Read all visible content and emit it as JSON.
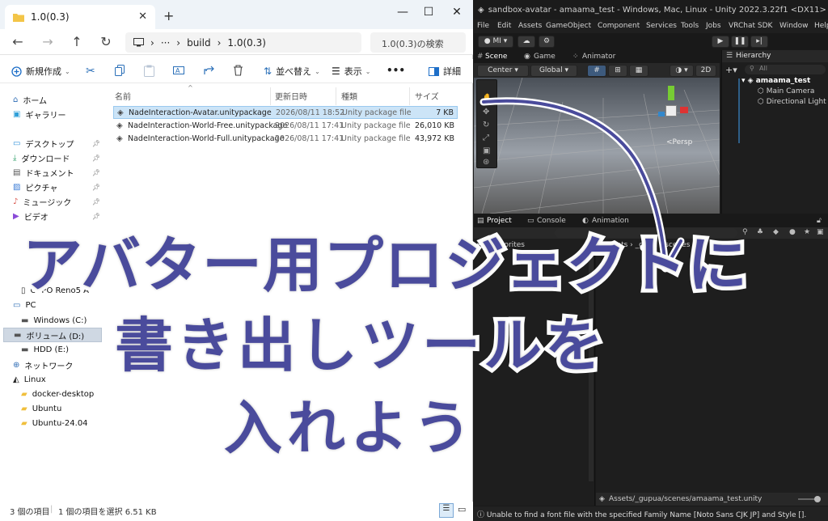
{
  "explorer": {
    "tab_title": "1.0(0.3)",
    "breadcrumb": [
      "build",
      "1.0(0.3)"
    ],
    "search_placeholder": "1.0(0.3)の検索",
    "toolbar": {
      "new_label": "新規作成",
      "sort_label": "並べ替え",
      "view_label": "表示",
      "more_label": "•••",
      "details_label": "詳細"
    },
    "sidebar": [
      {
        "label": "ホーム",
        "icon": "home-icon"
      },
      {
        "label": "ギャラリー",
        "icon": "gallery-icon"
      },
      {
        "label": "デスクトップ",
        "icon": "desktop-icon",
        "pinned": true
      },
      {
        "label": "ダウンロード",
        "icon": "download-icon",
        "pinned": true
      },
      {
        "label": "ドキュメント",
        "icon": "document-icon",
        "pinned": true
      },
      {
        "label": "ピクチャ",
        "icon": "picture-icon",
        "pinned": true
      },
      {
        "label": "ミュージック",
        "icon": "music-icon",
        "pinned": true
      },
      {
        "label": "ビデオ",
        "icon": "video-icon",
        "pinned": true
      },
      {
        "label": "OPPO Reno5 A",
        "icon": "phone-icon"
      },
      {
        "label": "PC",
        "icon": "pc-icon"
      },
      {
        "label": "Windows (C:)",
        "icon": "drive-icon"
      },
      {
        "label": "ボリューム (D:)",
        "icon": "drive-icon",
        "selected": true
      },
      {
        "label": "HDD (E:)",
        "icon": "drive-icon"
      },
      {
        "label": "ネットワーク",
        "icon": "network-icon"
      },
      {
        "label": "Linux",
        "icon": "linux-icon"
      },
      {
        "label": "docker-desktop",
        "icon": "folder-icon"
      },
      {
        "label": "Ubuntu",
        "icon": "folder-icon"
      },
      {
        "label": "Ubuntu-24.04",
        "icon": "folder-icon"
      }
    ],
    "columns": [
      "名前",
      "更新日時",
      "種類",
      "サイズ"
    ],
    "files": [
      {
        "name": "NadeInteraction-Avatar.unitypackage",
        "date": "2026/08/11 18:52",
        "type": "Unity package file",
        "size": "7 KB",
        "selected": true
      },
      {
        "name": "NadeInteraction-World-Free.unitypackage",
        "date": "2026/08/11 17:41",
        "type": "Unity package file",
        "size": "26,010 KB"
      },
      {
        "name": "NadeInteraction-World-Full.unitypackage",
        "date": "2026/08/11 17:41",
        "type": "Unity package file",
        "size": "43,972 KB"
      }
    ],
    "status": {
      "count": "3 個の項目",
      "selection": "1 個の項目を選択 6.51 KB"
    }
  },
  "unity": {
    "title": "sandbox-avatar - amaama_test - Windows, Mac, Linux - Unity 2022.3.22f1 <DX11>",
    "menu": [
      "File",
      "Edit",
      "Assets",
      "GameObject",
      "Component",
      "Services",
      "Tools",
      "Jobs",
      "VRChat SDK",
      "Window",
      "Help"
    ],
    "account": "MI",
    "scene_tabs": [
      "Scene",
      "Game",
      "Animator"
    ],
    "pivot": "Center",
    "space": "Global",
    "twod": "2D",
    "persp": "<Persp",
    "hierarchy_tab": "Hierarchy",
    "hierarchy_search": "All",
    "hierarchy": [
      "amaama_test",
      "Main Camera",
      "Directional Light"
    ],
    "bottom_tabs": [
      "Project",
      "Console",
      "Animation"
    ],
    "project_tree": "Favorites",
    "project_path": [
      "Assets",
      "_gupu",
      "scenes"
    ],
    "footer_path": "Assets/_gupua/scenes/amaama_test.unity",
    "status_message": "Unable to find a font file with the specified Family Name [Noto Sans CJK JP] and Style []."
  },
  "overlay": {
    "line1": "アバター用プロジェクトに",
    "line2": "書き出しツールを",
    "line3": "入れよう",
    "color": "#4a4b9c"
  }
}
